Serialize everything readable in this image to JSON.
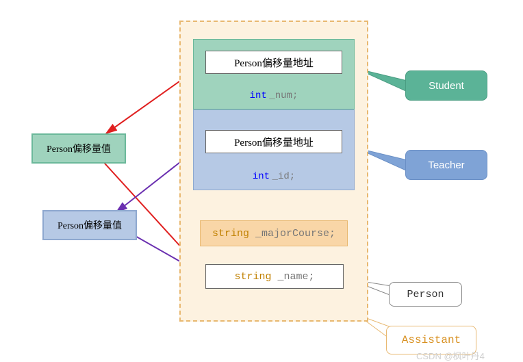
{
  "left_boxes": {
    "green_label": "Person偏移量值",
    "blue_label": "Person偏移量值"
  },
  "container": {
    "student": {
      "addr_label": "Person偏移量地址",
      "field_type": "int",
      "field_name": "_num;"
    },
    "teacher": {
      "addr_label": "Person偏移量地址",
      "field_type": "int",
      "field_name": "_id;"
    },
    "major": {
      "type": "string",
      "name": "_majorCourse;"
    },
    "name": {
      "type": "string",
      "name": "_name;"
    }
  },
  "callouts": {
    "student": "Student",
    "teacher": "Teacher",
    "person": "Person",
    "assistant": "Assistant"
  },
  "watermark": "CSDN @枫叶丹4"
}
